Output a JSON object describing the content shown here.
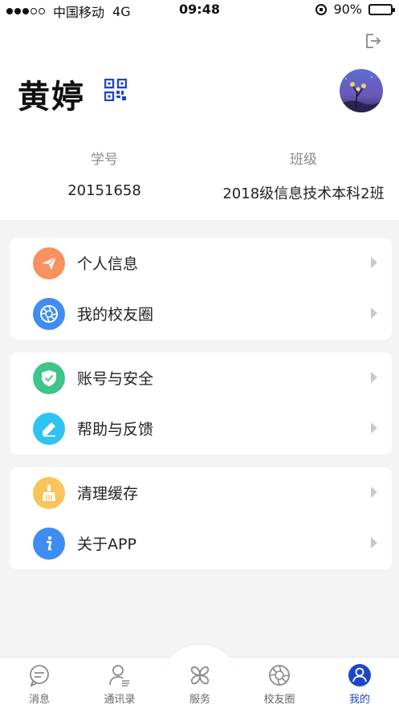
{
  "status_bar": {
    "carrier": "中国移动",
    "network": "4G",
    "time": "09:48",
    "battery": "90%",
    "battery_level": 0.9
  },
  "profile": {
    "name": "黄婷",
    "student_id_label": "学号",
    "student_id": "20151658",
    "class_label": "班级",
    "class_value": "2018级信息技术本科2班"
  },
  "menu_groups": [
    {
      "items": [
        {
          "label": "个人信息",
          "icon": "paper-plane-icon",
          "color": "#f7915f"
        },
        {
          "label": "我的校友圈",
          "icon": "aperture-icon",
          "color": "#3f8cf2"
        }
      ]
    },
    {
      "items": [
        {
          "label": "账号与安全",
          "icon": "shield-check-icon",
          "color": "#3ec58a"
        },
        {
          "label": "帮助与反馈",
          "icon": "pencil-icon",
          "color": "#2ec3f0"
        }
      ]
    },
    {
      "items": [
        {
          "label": "清理缓存",
          "icon": "broom-icon",
          "color": "#f9c45a"
        },
        {
          "label": "关于APP",
          "icon": "info-icon",
          "color": "#3f8cf2"
        }
      ]
    }
  ],
  "tab_bar": {
    "tabs": [
      {
        "label": "消息",
        "icon": "chat-icon"
      },
      {
        "label": "通讯录",
        "icon": "contacts-icon"
      },
      {
        "label": "服务",
        "icon": "clover-icon"
      },
      {
        "label": "校友圈",
        "icon": "aperture-icon"
      },
      {
        "label": "我的",
        "icon": "user-icon",
        "active": true
      }
    ],
    "active_color": "#1e46c8"
  }
}
